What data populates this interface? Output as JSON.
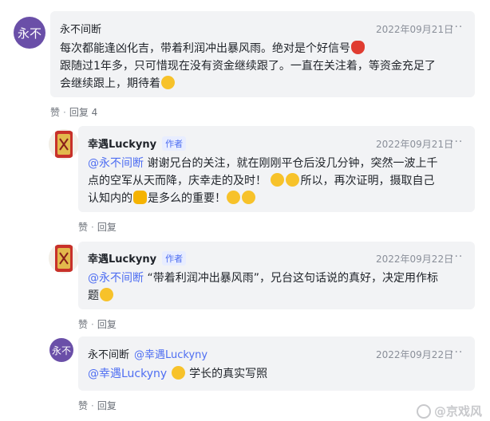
{
  "comments": [
    {
      "avatar_text": "永不",
      "name": "永不间断",
      "date": "2022年09月21日",
      "more": "···",
      "line1": "每次都能逢凶化吉，带着利润冲出暴风雨。绝对是个好信号",
      "line2": "跟随过1年多，只可惜现在没有资金继续跟了。一直在关注着，等资金充足了",
      "line3": "会继续跟上，期待着",
      "like": "赞",
      "reply": "回复 4"
    },
    {
      "name": "幸遇Luckyny",
      "tag": "作者",
      "date": "2022年09月21日",
      "more": "···",
      "mention": "@永不间断",
      "line1": " 谢谢兄台的关注，就在刚刚平仓后没几分钟，突然一波上千",
      "line2": "点的空军从天而降，庆幸走的及时！",
      "line2b": "所以，再次证明，摄取自己",
      "line3a": "认知内的",
      "line3b": "是多么的重要！",
      "like": "赞",
      "reply": "回复"
    },
    {
      "name": "幸遇Luckyny",
      "tag": "作者",
      "date": "2022年09月22日",
      "more": "···",
      "mention": "@永不间断",
      "line1": " “带着利润冲出暴风雨”，兄台这句话说的真好，决定用作标",
      "line2": "题",
      "like": "赞",
      "reply": "回复"
    },
    {
      "avatar_text": "永不",
      "name": "永不间断",
      "reply_to": "@幸遇Luckyny",
      "date": "2022年09月22日",
      "more": "···",
      "mention": "@幸遇Luckyny",
      "line1": " 学长的真实写照",
      "like": "赞",
      "reply": "回复"
    }
  ],
  "watermark": "@京戏风",
  "colors": {
    "accent": "#4e6ef2",
    "bubble": "#f2f3f5",
    "avatar": "#6a4fa8"
  },
  "icons": [
    "more-icon",
    "thumbs-up-emoji",
    "rose-emoji",
    "smile-emoji",
    "money-bag-emoji",
    "muscle-emoji"
  ]
}
